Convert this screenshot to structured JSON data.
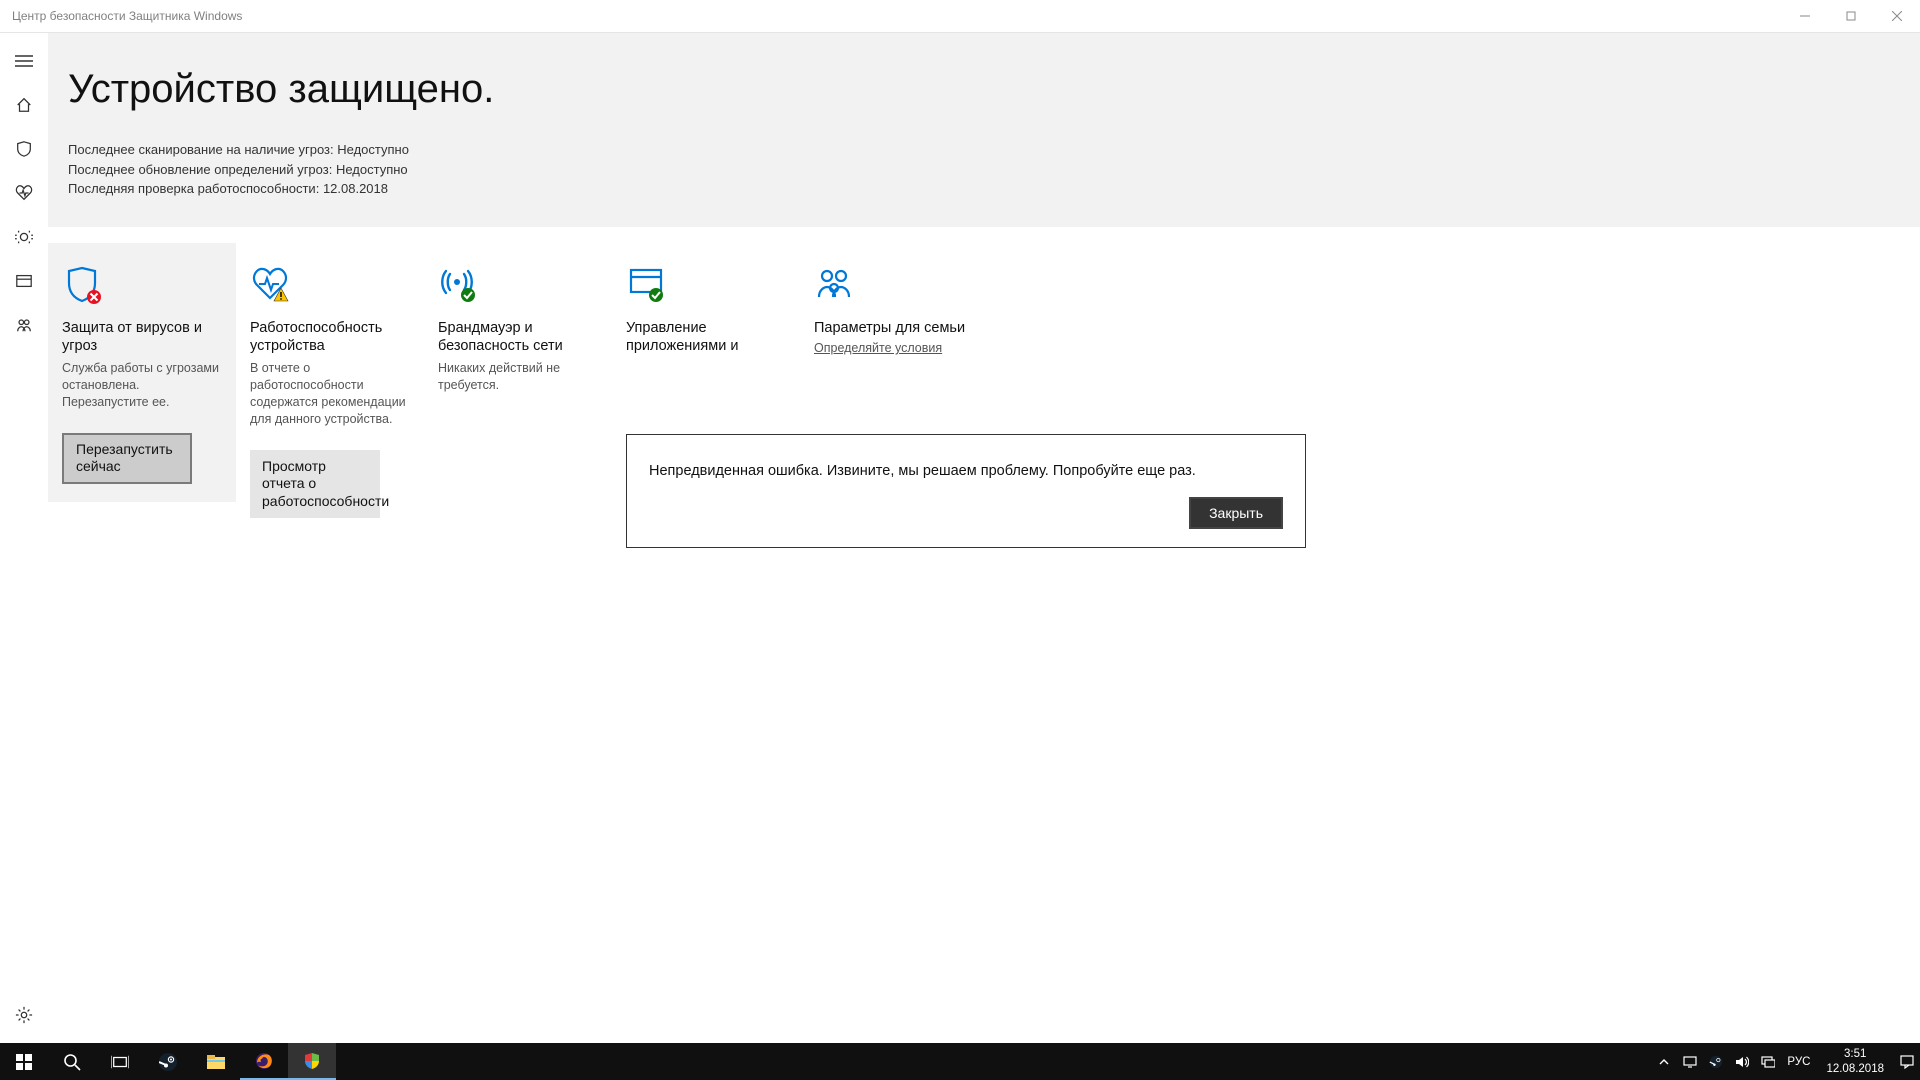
{
  "window": {
    "title": "Центр безопасности Защитника Windows"
  },
  "page": {
    "title": "Устройство защищено.",
    "status": {
      "scan_label": "Последнее сканирование на наличие угроз:",
      "scan_value": "Недоступно",
      "defs_label": "Последнее обновление определений угроз:",
      "defs_value": "Недоступно",
      "health_label": "Последняя проверка работоспособности:",
      "health_value": "12.08.2018"
    }
  },
  "tiles": [
    {
      "title": "Защита от вирусов и угроз",
      "desc": "Служба работы с угрозами остановлена. Перезапустите ее.",
      "button": "Перезапустить сейчас"
    },
    {
      "title": "Работоспособность устройства",
      "desc": "В отчете о работоспособности содержатся рекомендации для данного устройства.",
      "button": "Просмотр отчета о работоспособности"
    },
    {
      "title": "Брандмауэр и безопасность сети",
      "desc": "Никаких действий не требуется."
    },
    {
      "title": "Управление приложениями и"
    },
    {
      "title": "Параметры для семьи",
      "link": "Определяйте условия"
    }
  ],
  "dialog": {
    "text": "Непредвиденная ошибка. Извините, мы решаем проблему. Попробуйте еще раз.",
    "close": "Закрыть"
  },
  "taskbar": {
    "lang": "РУС",
    "time": "3:51",
    "date": "12.08.2018"
  }
}
